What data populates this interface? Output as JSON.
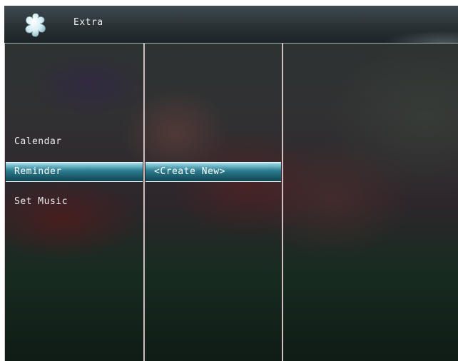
{
  "header": {
    "title": "Extra",
    "icon": "extra-app-icon"
  },
  "menu": {
    "items": [
      {
        "label": "Calendar",
        "selected": false
      },
      {
        "label": "Reminder",
        "selected": true
      },
      {
        "label": "Set Music",
        "selected": false
      }
    ]
  },
  "submenu": {
    "items": [
      {
        "label": "<Create New>",
        "selected": true
      }
    ]
  },
  "colors": {
    "highlight": "#2c7d8f",
    "highlight_light": "#d8f3f8",
    "titlebar": "#2a3236",
    "divider": "#e9d8d8",
    "text": "#eeeeee"
  }
}
